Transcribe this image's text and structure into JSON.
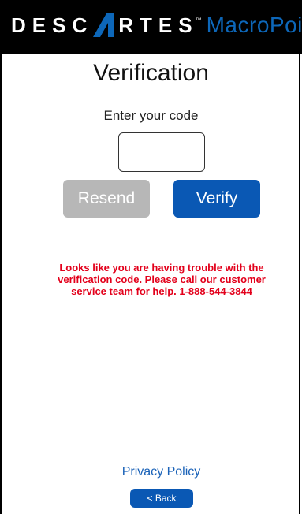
{
  "header": {
    "brand_word_left": "DESC",
    "brand_word_right": "RTES",
    "brand_tm": "™",
    "product": "MacroPoint",
    "logo_icon": "descartes-a-mark-icon",
    "colors": {
      "background": "#000000",
      "brand_text": "#ffffff",
      "product_text": "#0d67b9",
      "mark": "#0d67b9"
    }
  },
  "page": {
    "title": "Verification",
    "prompt": "Enter your code"
  },
  "code_input": {
    "value": "",
    "placeholder": ""
  },
  "buttons": {
    "resend": "Resend",
    "verify": "Verify",
    "back": "< Back"
  },
  "error_message": "Looks like you are having trouble with the verification code.  Please call our customer service team for help.  1-888-544-3844",
  "footer": {
    "privacy_link": "Privacy Policy"
  },
  "colors": {
    "primary": "#0a58b4",
    "disabled": "#b7b7b7",
    "error": "#e3001b",
    "link": "#1a62b8"
  }
}
